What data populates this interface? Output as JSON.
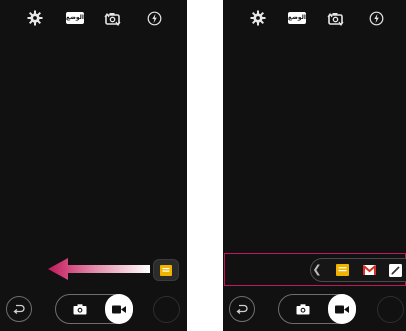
{
  "top_bar": {
    "settings_icon": "gear-icon",
    "mode_badge_text": "الوضع",
    "switch_camera_icon": "camera-switch-icon",
    "flash_icon": "flash-auto-icon"
  },
  "bottom_bar": {
    "back_icon": "back-arrow-icon",
    "photo_icon": "camera-icon",
    "video_icon": "video-camera-icon",
    "gallery_icon": "gallery-thumbnail"
  },
  "left_panel": {
    "gesture": "swipe-left-arrow",
    "handle_icon": "memo-icon"
  },
  "right_panel": {
    "shortcut_bar": {
      "collapse_icon": "chevron-left-icon",
      "items": [
        {
          "icon": "memo-icon"
        },
        {
          "icon": "gmail-icon"
        },
        {
          "icon": "pen-icon"
        }
      ]
    }
  },
  "colors": {
    "highlight": "#c2185b",
    "accent_yellow": "#f0b400",
    "gmail_red": "#d93025",
    "background": "#111111"
  }
}
